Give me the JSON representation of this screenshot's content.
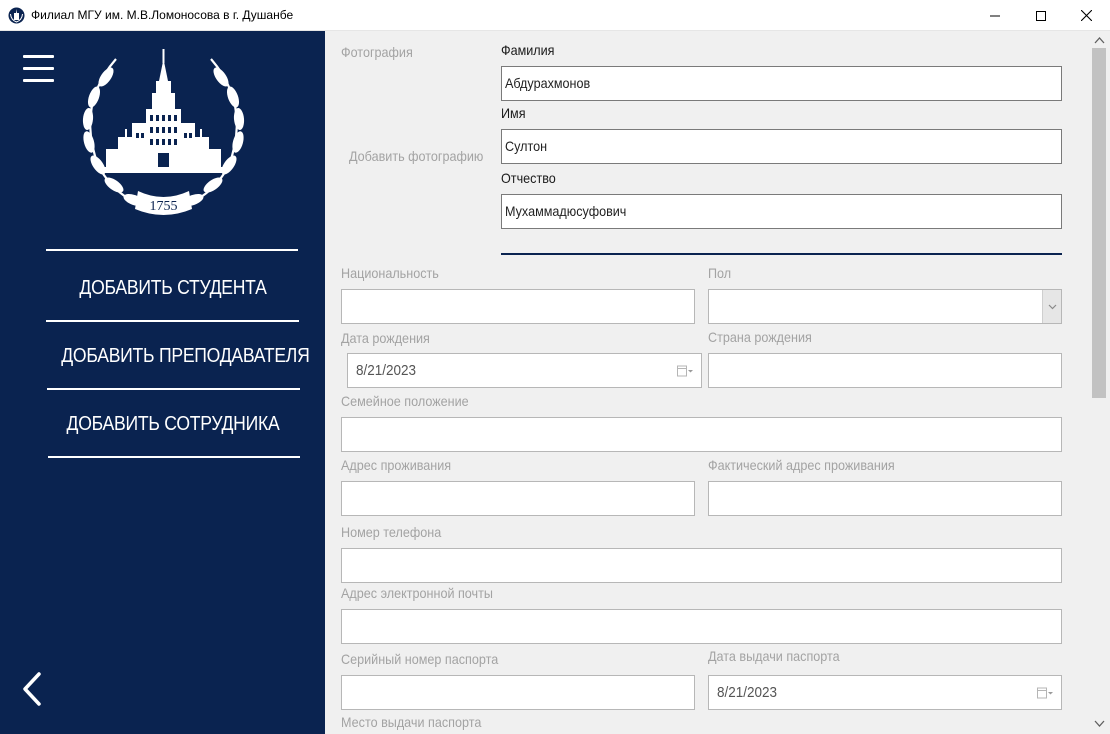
{
  "window": {
    "title": "Филиал МГУ им. М.В.Ломоносова в г. Душанбе",
    "app_icon": "university-emblem-icon",
    "controls": [
      "minimize-icon",
      "maximize-icon",
      "close-icon"
    ]
  },
  "sidebar": {
    "background": "#0a2350",
    "menu_icon": "hamburger-icon",
    "emblem": {
      "icon": "msu-emblem-icon",
      "year": "1755"
    },
    "nav": [
      {
        "label": "ДОБАВИТЬ СТУДЕНТА"
      },
      {
        "label": "ДОБАВИТЬ ПРЕПОДАВАТЕЛЯ"
      },
      {
        "label": "ДОБАВИТЬ СОТРУДНИКА"
      }
    ],
    "back_icon": "chevron-left-icon"
  },
  "form": {
    "photo": {
      "label": "Фотография",
      "add_label": "Добавить фотографию"
    },
    "surname": {
      "label": "Фамилия",
      "value": "Абдурахмонов"
    },
    "name": {
      "label": "Имя",
      "value": "Султон"
    },
    "patronymic": {
      "label": "Отчество",
      "value": "Мухаммадюсуфович"
    },
    "nationality": {
      "label": "Национальность",
      "value": ""
    },
    "gender": {
      "label": "Пол",
      "value": ""
    },
    "birth_date": {
      "label": "Дата рождения",
      "value": "8/21/2023"
    },
    "birth_country": {
      "label": "Страна рождения",
      "value": ""
    },
    "marital_status": {
      "label": "Семейное положение",
      "value": ""
    },
    "address": {
      "label": "Адрес проживания",
      "value": ""
    },
    "actual_address": {
      "label": "Фактический адрес проживания",
      "value": ""
    },
    "phone": {
      "label": "Номер телефона",
      "value": ""
    },
    "email": {
      "label": "Адрес электронной почты",
      "value": ""
    },
    "passport_serial": {
      "label": "Серийный номер паспорта",
      "value": ""
    },
    "passport_date": {
      "label": "Дата выдачи паспорта",
      "value": "8/21/2023"
    },
    "passport_place": {
      "label": "Место выдачи паспорта"
    }
  },
  "colors": {
    "accent": "#0a2350",
    "content_bg": "#f0f0f0",
    "label_gray": "#a3a3a3"
  }
}
